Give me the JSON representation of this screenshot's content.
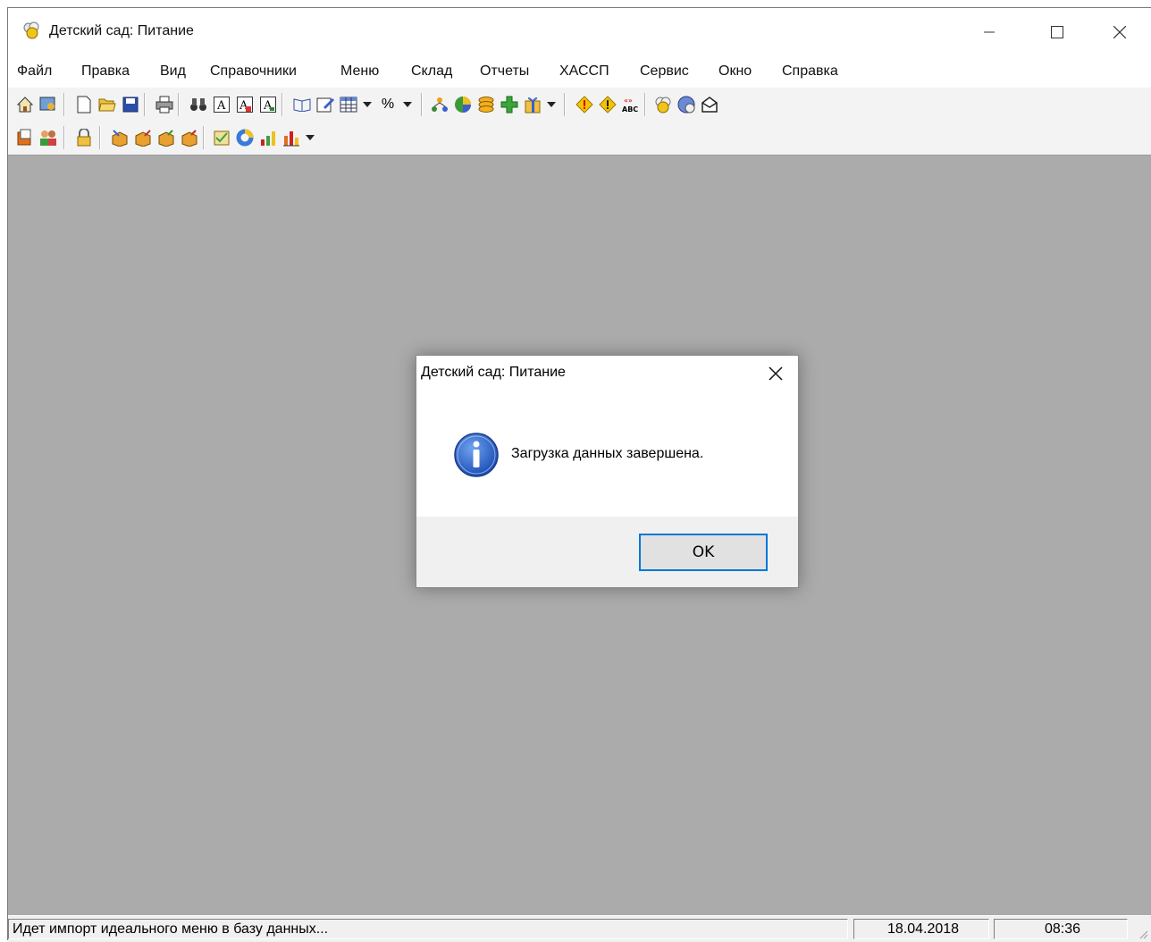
{
  "window": {
    "title": "Детский сад: Питание"
  },
  "menubar": {
    "items": [
      "Файл",
      "Правка",
      "Вид",
      "Справочники",
      "Меню",
      "Склад",
      "Отчеты",
      "ХАССП",
      "Сервис",
      "Окно",
      "Справка"
    ]
  },
  "toolbar1": {
    "percent_label": "%",
    "abc_label": "ABC",
    "icons": [
      "home-icon",
      "window-users-icon",
      "new-document-icon",
      "open-folder-icon",
      "save-icon",
      "print-icon",
      "binoculars-icon",
      "font-a-icon",
      "font-a-red-icon",
      "font-a-box-icon",
      "book-icon",
      "edit-note-icon",
      "table-icon",
      "percent-icon",
      "diagram-icon",
      "pie-chart-icon",
      "coins-icon",
      "add-icon",
      "gift-icon",
      "warning-icon",
      "warning-alt-icon",
      "spellcheck-icon",
      "chef-icon",
      "globe-icon",
      "mail-icon"
    ]
  },
  "toolbar2": {
    "icons": [
      "document-open-icon",
      "people-icon",
      "lock-icon",
      "box-in-icon",
      "box-out-icon",
      "box-green-icon",
      "box-red-icon",
      "checklist-icon",
      "ring-chart-icon",
      "growth-chart-icon",
      "bar-chart-icon"
    ]
  },
  "dialog": {
    "title": "Детский сад: Питание",
    "message": "Загрузка данных завершена.",
    "ok_label": "OK"
  },
  "statusbar": {
    "message": "Идет импорт идеального меню в базу данных...",
    "date": "18.04.2018",
    "time": "08:36"
  },
  "colors": {
    "workspace": "#ababab",
    "accent": "#0078d7"
  }
}
